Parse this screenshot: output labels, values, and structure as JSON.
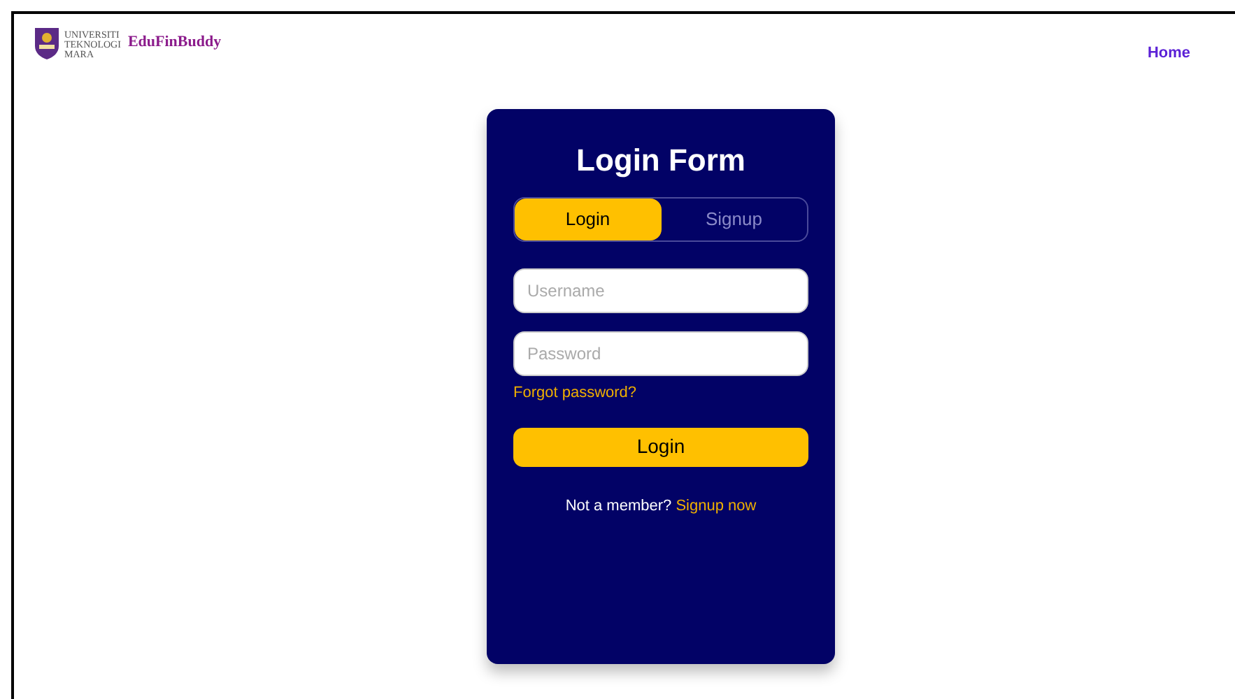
{
  "header": {
    "logo_lines": [
      "UNIVERSITI",
      "TEKNOLOGI",
      "MARA"
    ],
    "brand": "EduFinBuddy",
    "nav": [
      {
        "label": "Home"
      }
    ]
  },
  "form": {
    "title": "Login Form",
    "tabs": [
      {
        "label": "Login",
        "selected": true
      },
      {
        "label": "Signup",
        "selected": false
      }
    ],
    "fields": [
      {
        "placeholder": "Username"
      },
      {
        "placeholder": "Password"
      }
    ],
    "forgot_link": "Forgot password?",
    "submit": "Login",
    "footer_text": "Not a member?",
    "footer_link": "Signup now"
  }
}
